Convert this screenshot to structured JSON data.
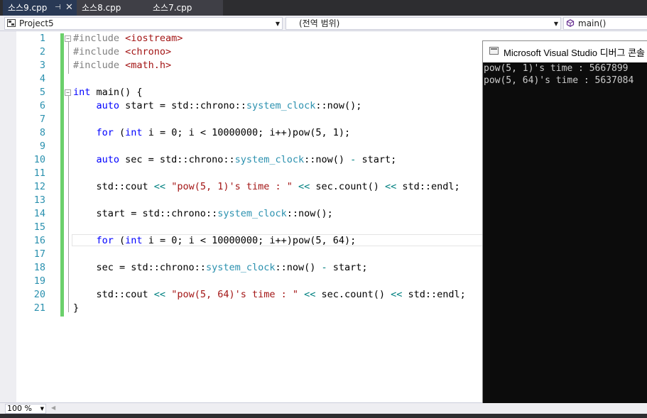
{
  "tabs": [
    {
      "label": "소스9.cpp",
      "active": true,
      "pin": "⊣",
      "close": "✕"
    },
    {
      "label": "소스8.cpp",
      "active": false
    },
    {
      "label": "소스7.cpp",
      "active": false
    }
  ],
  "navbar": {
    "project": "Project5",
    "scope": "(전역 범위)",
    "member": "main()"
  },
  "code_lines": [
    {
      "n": "1",
      "fold": "−",
      "tokens": [
        [
          "pp",
          "#include "
        ],
        [
          "str",
          "<iostream>"
        ]
      ]
    },
    {
      "n": "2",
      "tokens": [
        [
          "pp",
          "#include "
        ],
        [
          "str",
          "<chrono>"
        ]
      ]
    },
    {
      "n": "3",
      "tokens": [
        [
          "pp",
          "#include "
        ],
        [
          "str",
          "<math.h>"
        ]
      ]
    },
    {
      "n": "4",
      "tokens": []
    },
    {
      "n": "5",
      "fold": "−",
      "tokens": [
        [
          "kw",
          "int"
        ],
        [
          "",
          " main() {"
        ]
      ]
    },
    {
      "n": "6",
      "tokens": [
        [
          "",
          "    "
        ],
        [
          "kw",
          "auto"
        ],
        [
          "",
          " start = std::chrono::"
        ],
        [
          "ty",
          "system_clock"
        ],
        [
          "",
          "::now();"
        ]
      ]
    },
    {
      "n": "7",
      "tokens": []
    },
    {
      "n": "8",
      "tokens": [
        [
          "",
          "    "
        ],
        [
          "kw",
          "for"
        ],
        [
          "",
          " ("
        ],
        [
          "kw",
          "int"
        ],
        [
          "",
          " i = 0; i < 10000000; i++)pow(5, 1);"
        ]
      ]
    },
    {
      "n": "9",
      "tokens": []
    },
    {
      "n": "10",
      "tokens": [
        [
          "",
          "    "
        ],
        [
          "kw",
          "auto"
        ],
        [
          "",
          " sec = std::chrono::"
        ],
        [
          "ty",
          "system_clock"
        ],
        [
          "",
          "::now() "
        ],
        [
          "op",
          "-"
        ],
        [
          "",
          " start;"
        ]
      ]
    },
    {
      "n": "11",
      "tokens": []
    },
    {
      "n": "12",
      "tokens": [
        [
          "",
          "    std::cout "
        ],
        [
          "op",
          "<<"
        ],
        [
          "",
          " "
        ],
        [
          "str",
          "\"pow(5, 1)'s time : \""
        ],
        [
          "",
          " "
        ],
        [
          "op",
          "<<"
        ],
        [
          "",
          " sec.count() "
        ],
        [
          "op",
          "<<"
        ],
        [
          "",
          " std::endl;"
        ]
      ]
    },
    {
      "n": "13",
      "tokens": []
    },
    {
      "n": "14",
      "tokens": [
        [
          "",
          "    start = std::chrono::"
        ],
        [
          "ty",
          "system_clock"
        ],
        [
          "",
          "::now();"
        ]
      ]
    },
    {
      "n": "15",
      "tokens": []
    },
    {
      "n": "16",
      "tokens": [
        [
          "",
          "    "
        ],
        [
          "kw",
          "for"
        ],
        [
          "",
          " ("
        ],
        [
          "kw",
          "int"
        ],
        [
          "",
          " i = 0; i < 10000000; i++)pow(5, 64);"
        ]
      ]
    },
    {
      "n": "17",
      "tokens": []
    },
    {
      "n": "18",
      "tokens": [
        [
          "",
          "    sec = std::chrono::"
        ],
        [
          "ty",
          "system_clock"
        ],
        [
          "",
          "::now() "
        ],
        [
          "op",
          "-"
        ],
        [
          "",
          " start;"
        ]
      ]
    },
    {
      "n": "19",
      "tokens": []
    },
    {
      "n": "20",
      "tokens": [
        [
          "",
          "    std::cout "
        ],
        [
          "op",
          "<<"
        ],
        [
          "",
          " "
        ],
        [
          "str",
          "\"pow(5, 64)'s time : \""
        ],
        [
          "",
          " "
        ],
        [
          "op",
          "<<"
        ],
        [
          "",
          " sec.count() "
        ],
        [
          "op",
          "<<"
        ],
        [
          "",
          " std::endl;"
        ]
      ]
    },
    {
      "n": "21",
      "tokens": [
        [
          "",
          "}"
        ]
      ]
    }
  ],
  "statusbar": {
    "zoom": "100 %"
  },
  "console": {
    "title": "Microsoft Visual Studio 디버그 콘솔",
    "lines": [
      "pow(5, 1)'s time : 5667899",
      "pow(5, 64)'s time : 5637084"
    ]
  },
  "colors": {
    "keyword": "#0000ff",
    "preprocessor": "#808080",
    "string": "#a31515",
    "type": "#2b91af",
    "operator": "#008080",
    "line_number": "#2b91af",
    "changed_marker": "#6bd06b",
    "tab_active": "#293955",
    "console_bg": "#0c0c0c"
  }
}
